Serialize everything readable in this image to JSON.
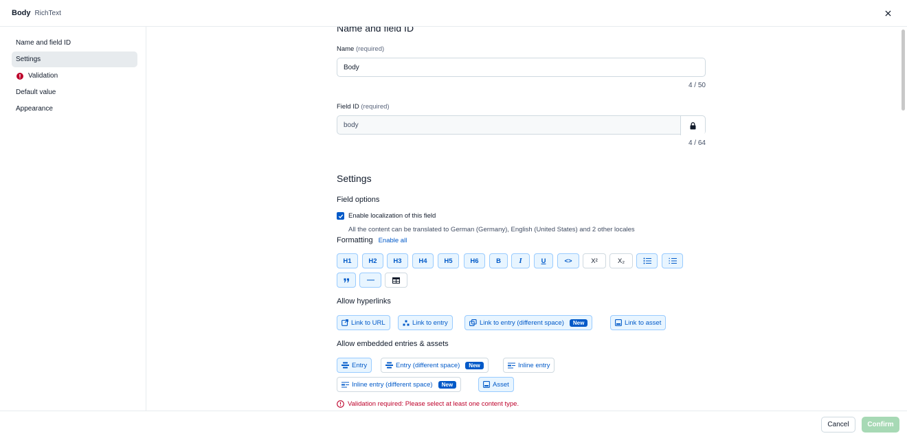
{
  "header": {
    "title": "Body",
    "subtitle": "RichText"
  },
  "sidebar": {
    "items": [
      {
        "label": "Name and field ID"
      },
      {
        "label": "Settings"
      },
      {
        "label": "Validation"
      },
      {
        "label": "Default value"
      },
      {
        "label": "Appearance"
      }
    ]
  },
  "name_section": {
    "title": "Name and field ID",
    "name_label": "Name",
    "name_required": "(required)",
    "name_value": "Body",
    "name_counter": "4 / 50",
    "id_label": "Field ID",
    "id_required": "(required)",
    "id_value": "body",
    "id_counter": "4 / 64"
  },
  "settings": {
    "title": "Settings",
    "field_options": "Field options",
    "localization_label": "Enable localization of this field",
    "localization_checked": true,
    "localization_help": "All the content can be translated to German (Germany), English (United States) and 2 other locales",
    "formatting_label": "Formatting",
    "enable_all": "Enable all",
    "format_buttons": [
      "H1",
      "H2",
      "H3",
      "H4",
      "H5",
      "H6",
      "B",
      "I",
      "U",
      "<>",
      "X²",
      "X₂"
    ],
    "hyperlinks_label": "Allow hyperlinks",
    "hyperlinks": [
      {
        "label": "Link to URL"
      },
      {
        "label": "Link to entry"
      },
      {
        "label": "Link to entry (different space)",
        "badge": "New"
      },
      {
        "label": "Link to asset"
      }
    ],
    "embedded_label": "Allow embedded entries & assets",
    "embedded": [
      {
        "label": "Entry"
      },
      {
        "label": "Entry (different space)",
        "badge": "New"
      },
      {
        "label": "Inline entry"
      },
      {
        "label": "Inline entry (different space)",
        "badge": "New"
      },
      {
        "label": "Asset"
      }
    ],
    "validation_error": "Validation required: Please select at least one content type."
  },
  "footer": {
    "cancel": "Cancel",
    "confirm": "Confirm"
  },
  "colors": {
    "primary": "#0059c8",
    "error": "#bd002a",
    "confirm_disabled": "#a7d9b5"
  }
}
